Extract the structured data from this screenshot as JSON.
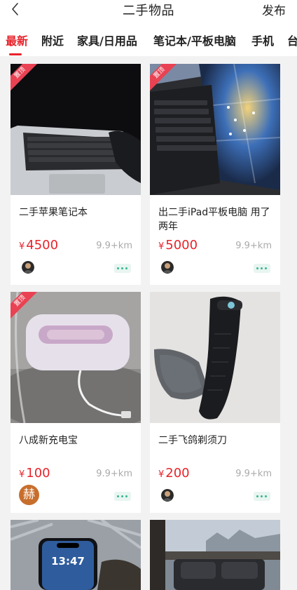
{
  "header": {
    "title": "二手物品",
    "publish_label": "发布"
  },
  "tabs": [
    {
      "label": "最新",
      "active": true
    },
    {
      "label": "附近"
    },
    {
      "label": "家具/日用品"
    },
    {
      "label": "笔记本/平板电脑"
    },
    {
      "label": "手机"
    },
    {
      "label": "台"
    }
  ],
  "pin_label": "置顶",
  "currency": "¥",
  "colors": {
    "accent": "#e8232b",
    "pin_ribbon": "#e94253",
    "more_dots": "#35b58e"
  },
  "items": [
    {
      "title": "二手苹果笔记本",
      "price": "4500",
      "distance": "9.9+km",
      "pinned": true,
      "image": "macbook-photo"
    },
    {
      "title": "出二手iPad平板电脑 用了两年",
      "price": "5000",
      "distance": "9.9+km",
      "pinned": true,
      "image": "ipad-keyboard-photo"
    },
    {
      "title": "八成新充电宝",
      "price": "100",
      "distance": "9.9+km",
      "pinned": true,
      "image": "power-bank-photo",
      "avatar_char": "赫"
    },
    {
      "title": "二手飞鸽剃须刀",
      "price": "200",
      "distance": "9.9+km",
      "pinned": false,
      "image": "shaver-photo"
    },
    {
      "image": "iphone-photo",
      "phone_time": "13:47"
    },
    {
      "image": "sofa-photo"
    }
  ]
}
